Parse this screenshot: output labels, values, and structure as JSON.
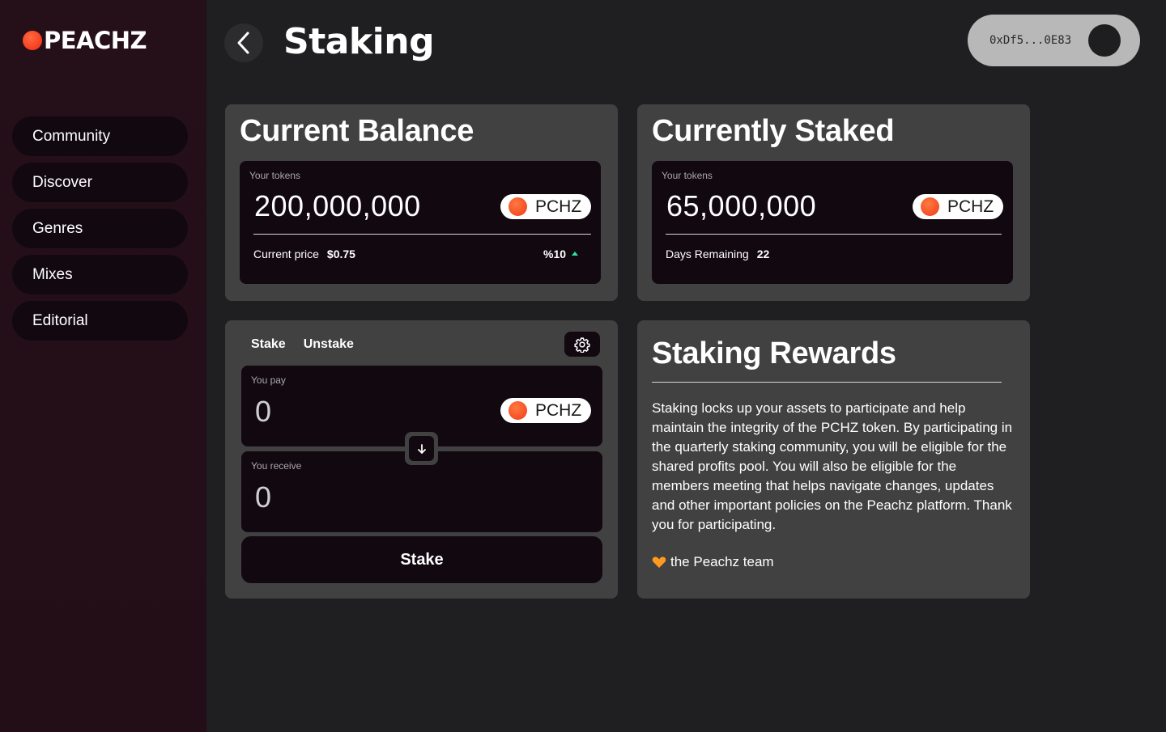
{
  "brand": {
    "name": "PEACHZ"
  },
  "sidebar": {
    "items": [
      {
        "label": "Community"
      },
      {
        "label": "Discover"
      },
      {
        "label": "Genres"
      },
      {
        "label": "Mixes"
      },
      {
        "label": "Editorial"
      }
    ]
  },
  "header": {
    "title": "Staking",
    "wallet_address": "0xDf5...0E83"
  },
  "current_balance": {
    "title": "Current Balance",
    "label": "Your tokens",
    "amount": "200,000,000",
    "token": "PCHZ",
    "price_label": "Current price",
    "price_value": "$0.75",
    "change": "%10",
    "change_direction": "up"
  },
  "currently_staked": {
    "title": "Currently Staked",
    "label": "Your tokens",
    "amount": "65,000,000",
    "token": "PCHZ",
    "days_label": "Days Remaining",
    "days_value": "22"
  },
  "stake_panel": {
    "tabs": [
      {
        "label": "Stake"
      },
      {
        "label": "Unstake"
      }
    ],
    "pay_label": "You pay",
    "pay_amount": "0",
    "pay_token": "PCHZ",
    "receive_label": "You receive",
    "receive_amount": "0",
    "button_label": "Stake"
  },
  "rewards": {
    "title": "Staking Rewards",
    "body": "Staking locks up your assets to participate and help maintain the integrity of the PCHZ token. By participating in the quarterly staking community, you will be eligible for the shared profits pool. You will also be eligible for the members meeting that helps navigate changes, updates and other important policies on the Peachz platform. Thank you for participating.",
    "signature": "the Peachz team"
  },
  "colors": {
    "accent_orange": "#f03a1b",
    "up_green": "#2ee59d",
    "card_bg": "#414141",
    "inner_bg": "#120810"
  }
}
